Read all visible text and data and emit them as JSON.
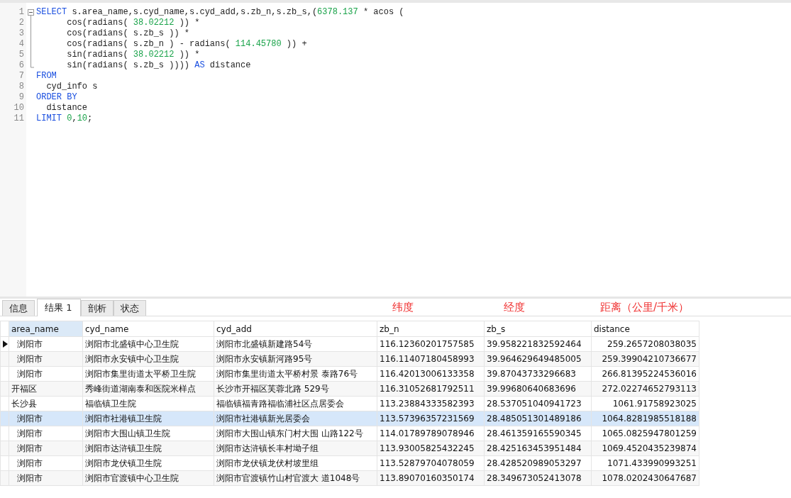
{
  "editor": {
    "lines": [
      {
        "number": "1",
        "expanded": true,
        "tokens": [
          {
            "kind": "keyword",
            "text": "SELECT"
          },
          {
            "kind": "plain",
            "text": " s.area_name,s.cyd_name,s.cyd_add,s.zb_n,s.zb_s,("
          },
          {
            "kind": "number",
            "text": "6378.137"
          },
          {
            "kind": "plain",
            "text": " * acos ("
          }
        ],
        "children": [
          {
            "number": "2",
            "tokens": [
              {
                "kind": "plain",
                "text": "      cos(radians( "
              },
              {
                "kind": "number",
                "text": "38.02212"
              },
              {
                "kind": "plain",
                "text": " )) *"
              }
            ]
          },
          {
            "number": "3",
            "tokens": [
              {
                "kind": "plain",
                "text": "      cos(radians( s.zb_s )) *"
              }
            ]
          },
          {
            "number": "4",
            "tokens": [
              {
                "kind": "plain",
                "text": "      cos(radians( s.zb_n ) - radians( "
              },
              {
                "kind": "number",
                "text": "114.45780"
              },
              {
                "kind": "plain",
                "text": " )) +"
              }
            ]
          },
          {
            "number": "5",
            "tokens": [
              {
                "kind": "plain",
                "text": "      sin(radians( "
              },
              {
                "kind": "number",
                "text": "38.02212"
              },
              {
                "kind": "plain",
                "text": " )) *"
              }
            ]
          },
          {
            "number": "6",
            "tokens": [
              {
                "kind": "plain",
                "text": "      sin(radians( s.zb_s )))) "
              },
              {
                "kind": "keyword",
                "text": "AS"
              },
              {
                "kind": "plain",
                "text": " distance"
              }
            ]
          }
        ]
      },
      {
        "number": "7",
        "tokens": [
          {
            "kind": "keyword",
            "text": "FROM"
          }
        ]
      },
      {
        "number": "8",
        "tokens": [
          {
            "kind": "plain",
            "text": "  cyd_info s"
          }
        ]
      },
      {
        "number": "9",
        "tokens": [
          {
            "kind": "keyword",
            "text": "ORDER BY"
          }
        ]
      },
      {
        "number": "10",
        "tokens": [
          {
            "kind": "plain",
            "text": "  distance"
          }
        ]
      },
      {
        "number": "11",
        "tokens": [
          {
            "kind": "keyword",
            "text": "LIMIT"
          },
          {
            "kind": "number",
            "text": " 0"
          },
          {
            "kind": "plain",
            "text": ","
          },
          {
            "kind": "number",
            "text": "10"
          },
          {
            "kind": "plain",
            "text": ";"
          }
        ]
      }
    ]
  },
  "tabs": [
    {
      "label": "信息",
      "selected": false
    },
    {
      "label": "结果 1",
      "selected": true
    },
    {
      "label": "剖析",
      "selected": false
    },
    {
      "label": "状态",
      "selected": false
    }
  ],
  "annotations": [
    "纬度",
    "经度",
    "距离（公里/千米）"
  ],
  "table": {
    "columns": [
      {
        "label": "area_name",
        "selected": true
      },
      {
        "label": "cyd_name",
        "selected": false
      },
      {
        "label": "cyd_add",
        "selected": false
      },
      {
        "label": "zb_n",
        "selected": false
      },
      {
        "label": "zb_s",
        "selected": false
      },
      {
        "label": "distance",
        "selected": false
      }
    ],
    "rows": [
      {
        "selected": true,
        "highlighted": false,
        "cells": [
          "  浏阳市",
          "浏阳市北盛镇中心卫生院",
          "浏阳市北盛镇新建路54号",
          "116.12360201757585",
          "39.958221832592464",
          "259.2657208038035"
        ]
      },
      {
        "selected": false,
        "highlighted": false,
        "cells": [
          "  浏阳市",
          "浏阳市永安镇中心卫生院",
          "浏阳市永安镇新河路95号",
          "116.11407180458993",
          "39.964629649485005",
          "259.39904210736677"
        ]
      },
      {
        "selected": false,
        "highlighted": false,
        "cells": [
          "  浏阳市",
          "浏阳市集里街道太平桥卫生院",
          "浏阳市集里街道太平桥村景 泰路76号",
          "116.42013006133358",
          "39.87043733296683",
          "266.81395224536016"
        ]
      },
      {
        "selected": false,
        "highlighted": false,
        "cells": [
          "开福区",
          "秀峰街道湖南泰和医院米样点",
          "长沙市开福区芙蓉北路 529号",
          "116.31052681792511",
          "39.99680640683696",
          "272.02274652793113"
        ]
      },
      {
        "selected": false,
        "highlighted": false,
        "cells": [
          "长沙县",
          "福临镇卫生院",
          "福临镇福青路福临浦社区点居委会",
          "113.23884333582393",
          "28.537051040941723",
          "1061.91758923025"
        ]
      },
      {
        "selected": false,
        "highlighted": true,
        "cells": [
          "  浏阳市",
          "浏阳市社港镇卫生院",
          "浏阳市社港镇新光居委会",
          "113.57396357231569",
          "28.485051301489186",
          "1064.8281985518188"
        ]
      },
      {
        "selected": false,
        "highlighted": false,
        "cells": [
          "  浏阳市",
          "浏阳市大围山镇卫生院",
          "浏阳市大围山镇东门村大围 山路122号",
          "114.01789789078946",
          "28.461359165590345",
          "1065.0825947801259"
        ]
      },
      {
        "selected": false,
        "highlighted": false,
        "cells": [
          "  浏阳市",
          "浏阳市达浒镇卫生院",
          "浏阳市达浒镇长丰村坳子组",
          "113.93005825432245",
          "28.425163453951484",
          "1069.4520435239874"
        ]
      },
      {
        "selected": false,
        "highlighted": false,
        "cells": [
          "  浏阳市",
          "浏阳市龙伏镇卫生院",
          "浏阳市龙伏镇龙伏村坡里组",
          "113.52879704078059",
          "28.428520989053297",
          "1071.433990993251"
        ]
      },
      {
        "selected": false,
        "highlighted": false,
        "cells": [
          "  浏阳市",
          "浏阳市官渡镇中心卫生院",
          "浏阳市官渡镇竹山村官渡大 道1048号",
          "113.89070160350174",
          "28.349673052413078",
          "1078.0202430647687"
        ]
      }
    ]
  }
}
